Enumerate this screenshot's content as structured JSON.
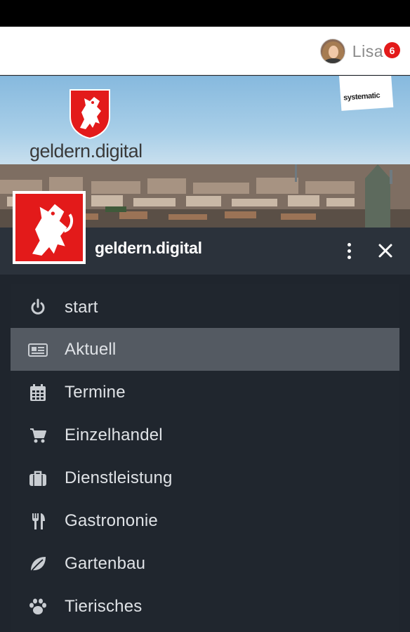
{
  "topbar": {
    "user_name": "Lisa",
    "notification_count": "6"
  },
  "hero": {
    "brand_text": "geldern.digital",
    "sponsor_text": "systematic"
  },
  "drawer": {
    "title": "geldern.digital",
    "menu": [
      {
        "label": "start",
        "icon": "power-icon",
        "active": false
      },
      {
        "label": "Aktuell",
        "icon": "newspaper-icon",
        "active": true
      },
      {
        "label": "Termine",
        "icon": "calendar-icon",
        "active": false
      },
      {
        "label": "Einzelhandel",
        "icon": "cart-icon",
        "active": false
      },
      {
        "label": "Dienstleistung",
        "icon": "briefcase-icon",
        "active": false
      },
      {
        "label": "Gastrononie",
        "icon": "cutlery-icon",
        "active": false
      },
      {
        "label": "Gartenbau",
        "icon": "leaf-icon",
        "active": false
      },
      {
        "label": "Tierisches",
        "icon": "paw-icon",
        "active": false
      }
    ]
  },
  "colors": {
    "brand_red": "#e31a1a",
    "drawer_bg": "#20262e",
    "header_bg": "#2b323b",
    "active_item_bg": "#545a62"
  }
}
